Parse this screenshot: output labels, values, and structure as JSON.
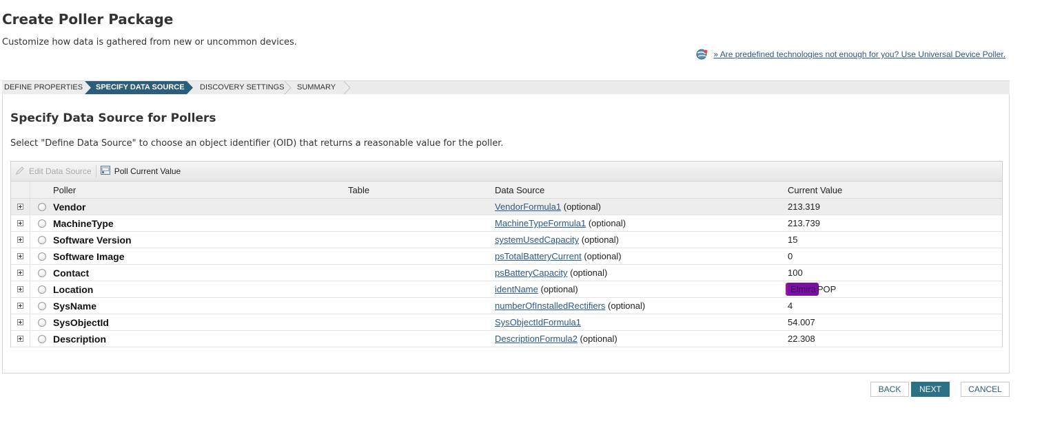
{
  "header": {
    "title": "Create Poller Package",
    "subtitle": "Customize how data is gathered from new or uncommon devices.",
    "udp_link": "» Are predefined technologies not enough for you? Use Universal Device Poller."
  },
  "wizard": {
    "steps": [
      {
        "label": "DEFINE PROPERTIES",
        "active": false
      },
      {
        "label": "SPECIFY DATA SOURCE",
        "active": true
      },
      {
        "label": "DISCOVERY SETTINGS",
        "active": false
      },
      {
        "label": "SUMMARY",
        "active": false
      }
    ],
    "active_color": "#2c5d79"
  },
  "section": {
    "title": "Specify Data Source for Pollers",
    "description": "Select \"Define Data Source\" to choose an object identifier (OID) that returns a reasonable value for the poller."
  },
  "toolbar": {
    "edit_label": "Edit Data Source",
    "poll_label": "Poll Current Value"
  },
  "grid": {
    "columns": [
      "Poller",
      "Table",
      "Data Source",
      "Current Value"
    ],
    "rows": [
      {
        "poller": "Vendor",
        "table": "",
        "source": "VendorFormula1",
        "optional": " (optional)",
        "value": "213.319"
      },
      {
        "poller": "MachineType",
        "table": "",
        "source": "MachineTypeFormula1",
        "optional": " (optional)",
        "value": "213.739"
      },
      {
        "poller": "Software Version",
        "table": "",
        "source": "systemUsedCapacity",
        "optional": " (optional)",
        "value": "15"
      },
      {
        "poller": "Software Image",
        "table": "",
        "source": "psTotalBatteryCurrent",
        "optional": " (optional)",
        "value": "0"
      },
      {
        "poller": "Contact",
        "table": "",
        "source": "psBatteryCapacity",
        "optional": " (optional)",
        "value": "100"
      },
      {
        "poller": "Location",
        "table": "",
        "source": "identName",
        "optional": " (optional)",
        "value_redacted": "Elmira",
        "value": "POP"
      },
      {
        "poller": "SysName",
        "table": "",
        "source": "numberOfInstalledRectifiers",
        "optional": " (optional)",
        "value": "4"
      },
      {
        "poller": "SysObjectId",
        "table": "",
        "source": "SysObjectIdFormula1",
        "optional": "",
        "value": "54.007"
      },
      {
        "poller": "Description",
        "table": "",
        "source": "DescriptionFormula2",
        "optional": " (optional)",
        "value": "22.308"
      }
    ]
  },
  "buttons": {
    "back": "BACK",
    "next": "NEXT",
    "cancel": "CANCEL"
  },
  "icons": {
    "udp": "udp-globe-icon",
    "edit": "pencil-icon",
    "poll": "poll-value-icon",
    "expander": "expand-plus-icon"
  }
}
